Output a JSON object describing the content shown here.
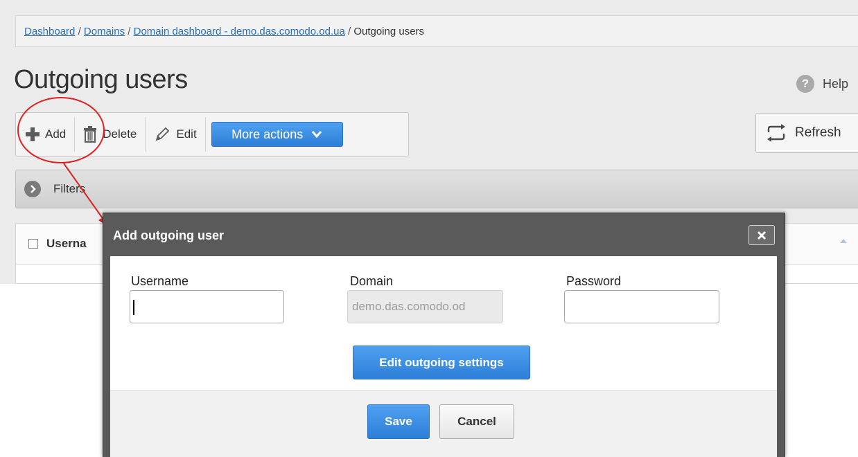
{
  "breadcrumb": {
    "items": [
      {
        "label": "Dashboard",
        "link": true
      },
      {
        "label": "Domains",
        "link": true
      },
      {
        "label": "Domain dashboard - demo.das.comodo.od.ua",
        "link": true
      },
      {
        "label": "Outgoing users",
        "link": false
      }
    ],
    "separator": "/"
  },
  "page": {
    "title": "Outgoing users",
    "help_label": "Help",
    "help_icon": "?"
  },
  "toolbar": {
    "add_label": "Add",
    "delete_label": "Delete",
    "edit_label": "Edit",
    "more_actions_label": "More actions",
    "refresh_label": "Refresh"
  },
  "filters": {
    "label": "Filters"
  },
  "table": {
    "columns": [
      "Userna"
    ]
  },
  "dialog": {
    "title": "Add outgoing user",
    "fields": {
      "username": {
        "label": "Username",
        "value": ""
      },
      "domain": {
        "label": "Domain",
        "value": "demo.das.comodo.od"
      },
      "password": {
        "label": "Password",
        "value": ""
      }
    },
    "edit_settings_label": "Edit outgoing settings",
    "save_label": "Save",
    "cancel_label": "Cancel"
  },
  "colors": {
    "accent": "#2d7fd8",
    "annotation": "#e02020",
    "dialog_header": "#5a5a5a"
  }
}
